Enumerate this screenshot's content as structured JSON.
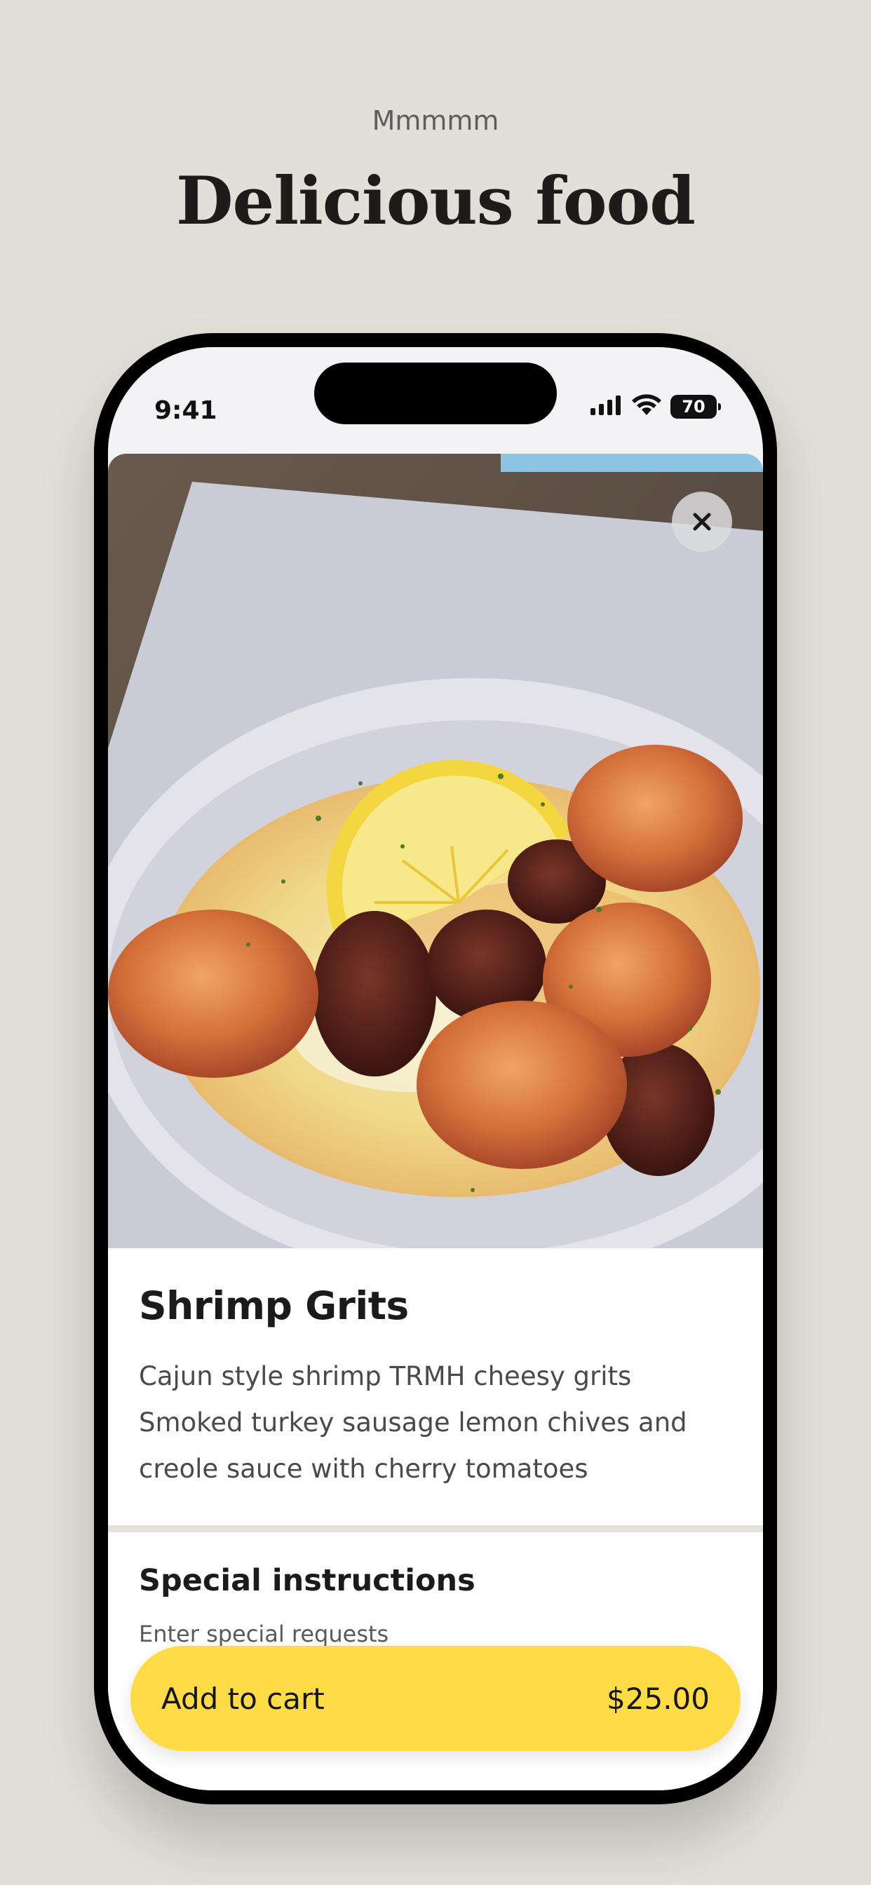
{
  "promo": {
    "eyebrow": "Mmmmm",
    "headline": "Delicious food"
  },
  "status_bar": {
    "time": "9:41",
    "battery": "70",
    "icons": [
      "cellular-signal-icon",
      "wifi-icon",
      "battery-icon"
    ]
  },
  "product": {
    "image_alt": "shrimp-and-grits-photo",
    "close_icon": "close-icon",
    "title": "Shrimp Grits",
    "description": "Cajun style shrimp TRMH cheesy grits Smoked turkey sausage lemon chives and creole sauce with cherry tomatoes"
  },
  "instructions": {
    "title": "Special instructions",
    "placeholder": "Enter special requests",
    "value": ""
  },
  "cart": {
    "label": "Add to cart",
    "price": "$25.00"
  },
  "colors": {
    "background": "#e2dfd8",
    "accent": "#ffdc47",
    "phone_frame": "#000000"
  }
}
